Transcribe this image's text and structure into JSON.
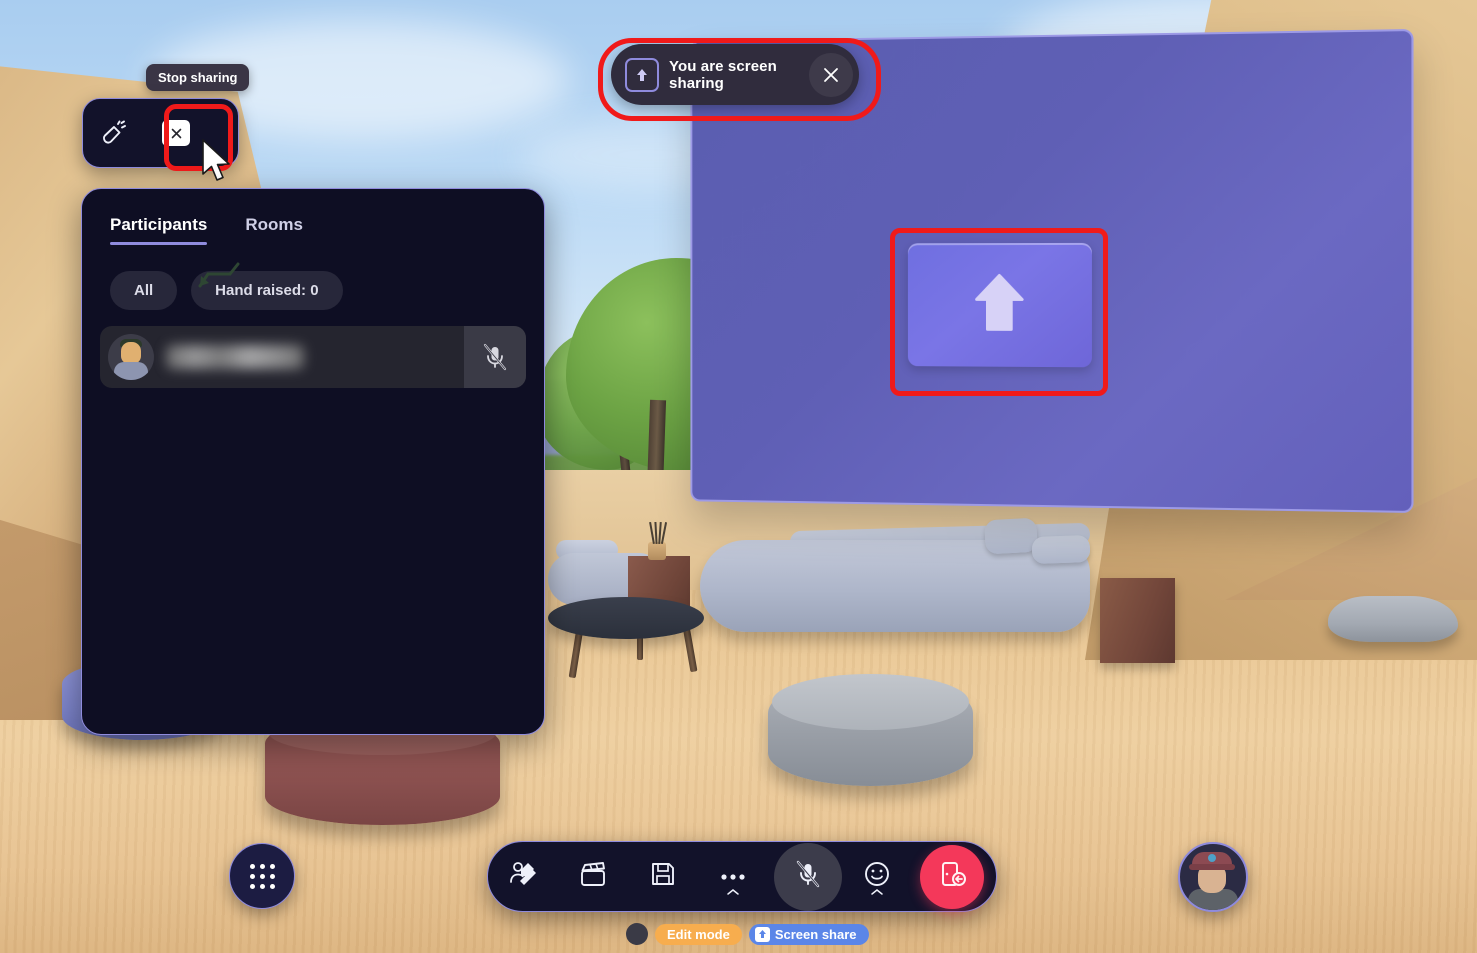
{
  "app": {
    "environment_name": "virtual-lounge-3d-scene"
  },
  "banner": {
    "icon": "screen-share-up-arrow-icon",
    "text": "You are screen sharing",
    "close_label": "✕"
  },
  "mini_toolbar": {
    "tooltip": "Stop sharing",
    "megaphone_icon": "megaphone-icon",
    "close_label": "✕"
  },
  "panel": {
    "tabs": [
      {
        "label": "Participants",
        "active": true
      },
      {
        "label": "Rooms",
        "active": false
      }
    ],
    "filters": [
      {
        "label": "All"
      },
      {
        "label": "Hand raised: 0"
      }
    ],
    "participants": [
      {
        "name": "",
        "name_redacted": true,
        "avatar": "avatar-participant",
        "mic": "microphone-muted-icon"
      }
    ]
  },
  "virtual_screen": {
    "placeholder_icon": "up-arrow-icon",
    "label": ""
  },
  "toolbar": {
    "buttons": [
      {
        "name": "avatar-edit",
        "icon": "avatar-edit-icon",
        "has_chevron": false
      },
      {
        "name": "clapperboard",
        "icon": "clapperboard-icon",
        "has_chevron": false
      },
      {
        "name": "save",
        "icon": "floppy-save-icon",
        "has_chevron": false
      },
      {
        "name": "more",
        "icon": "more-dots-icon",
        "has_chevron": true
      },
      {
        "name": "microphone",
        "icon": "microphone-muted-icon",
        "has_chevron": false,
        "muted": true
      },
      {
        "name": "reactions",
        "icon": "smiley-face-icon",
        "has_chevron": true
      },
      {
        "name": "leave",
        "icon": "leave-door-icon",
        "has_chevron": false
      }
    ],
    "grid_button": "apps-grid-icon",
    "self_avatar": "self-avatar"
  },
  "status": {
    "badges": [
      {
        "label": "Edit mode",
        "color": "#f7ad4e",
        "icon": null
      },
      {
        "label": "Screen share",
        "color": "#5b86e8",
        "icon": "screen-share-up-arrow-icon"
      }
    ]
  },
  "colors": {
    "panel_bg": "#0e0e23",
    "panel_border": "#8f8bdd",
    "accent_purple": "#8f8bdd",
    "annotation_red": "#f01a1a",
    "leave_red": "#f4385a",
    "edit_mode_orange": "#f7ad4e",
    "screen_share_blue": "#5b86e8"
  }
}
